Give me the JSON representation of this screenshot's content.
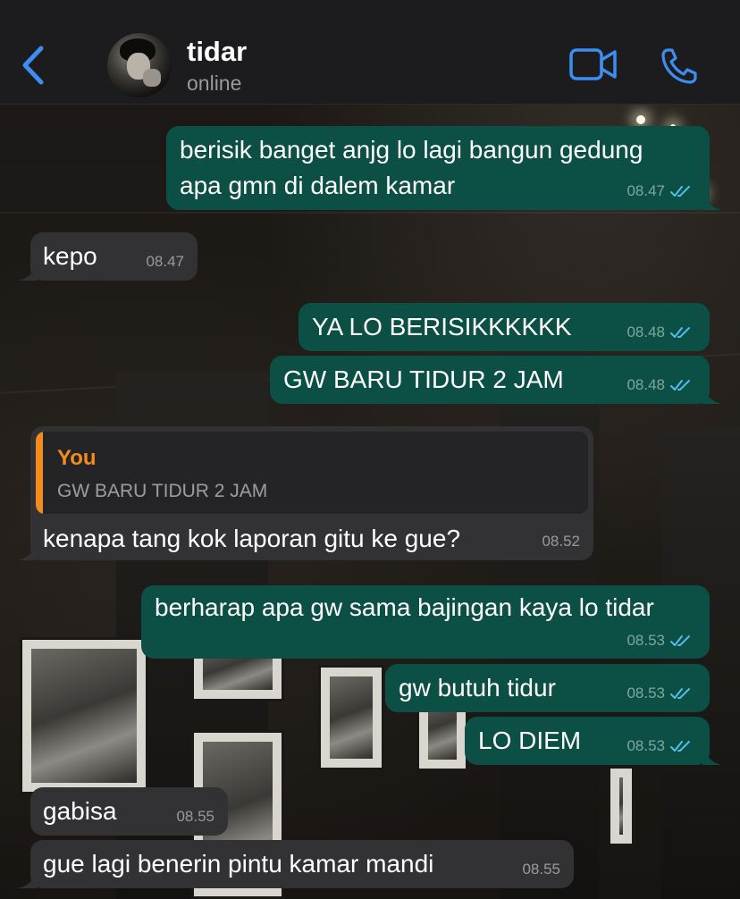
{
  "header": {
    "contact_name": "tidar",
    "contact_status": "online",
    "back_icon": "chevron-left-icon",
    "video_icon": "video-call-icon",
    "call_icon": "phone-icon",
    "accent_color": "#3d8ef0"
  },
  "colors": {
    "outgoing_bubble": "#0c4f45",
    "incoming_bubble": "#323234",
    "quote_accent": "#f28b20",
    "read_tick": "#53bdeb"
  },
  "messages": [
    {
      "direction": "out",
      "lines": [
        "berisik banget anjg lo lagi bangun gedung",
        "apa gmn di dalem kamar"
      ],
      "time": "08.47",
      "status": "read"
    },
    {
      "direction": "in",
      "lines": [
        "kepo"
      ],
      "time": "08.47"
    },
    {
      "direction": "out",
      "lines": [
        "YA LO BERISIKKKKKK"
      ],
      "time": "08.48",
      "status": "read"
    },
    {
      "direction": "out",
      "lines": [
        "GW BARU TIDUR 2 JAM"
      ],
      "time": "08.48",
      "status": "read"
    },
    {
      "direction": "in",
      "reply_to": {
        "name": "You",
        "text": "GW BARU TIDUR 2 JAM"
      },
      "lines": [
        "kenapa tang kok laporan gitu ke gue?"
      ],
      "time": "08.52"
    },
    {
      "direction": "out",
      "lines": [
        "berharap apa gw sama bajingan kaya lo tidar"
      ],
      "time": "08.53",
      "status": "read"
    },
    {
      "direction": "out",
      "lines": [
        "gw butuh tidur"
      ],
      "time": "08.53",
      "status": "read"
    },
    {
      "direction": "out",
      "lines": [
        "LO DIEM"
      ],
      "time": "08.53",
      "status": "read"
    },
    {
      "direction": "in",
      "lines": [
        "gabisa"
      ],
      "time": "08.55"
    },
    {
      "direction": "in",
      "lines": [
        "gue lagi benerin pintu kamar mandi"
      ],
      "time": "08.55"
    }
  ]
}
